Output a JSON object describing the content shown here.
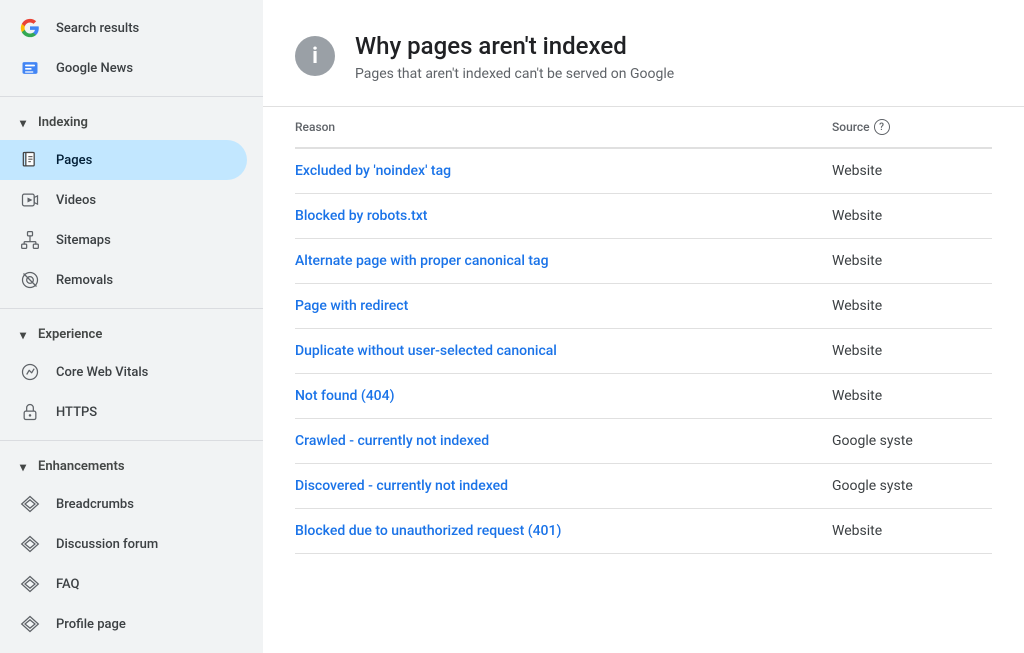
{
  "sidebar": {
    "top_items": [
      {
        "id": "search-results",
        "label": "Search results",
        "icon": "google-icon"
      },
      {
        "id": "google-news",
        "label": "Google News",
        "icon": "google-news-icon"
      }
    ],
    "sections": [
      {
        "id": "indexing",
        "label": "Indexing",
        "expanded": true,
        "items": [
          {
            "id": "pages",
            "label": "Pages",
            "icon": "pages-icon",
            "active": true
          },
          {
            "id": "videos",
            "label": "Videos",
            "icon": "videos-icon",
            "active": false
          },
          {
            "id": "sitemaps",
            "label": "Sitemaps",
            "icon": "sitemaps-icon",
            "active": false
          },
          {
            "id": "removals",
            "label": "Removals",
            "icon": "removals-icon",
            "active": false
          }
        ]
      },
      {
        "id": "experience",
        "label": "Experience",
        "expanded": true,
        "items": [
          {
            "id": "core-web-vitals",
            "label": "Core Web Vitals",
            "icon": "core-web-vitals-icon",
            "active": false
          },
          {
            "id": "https",
            "label": "HTTPS",
            "icon": "https-icon",
            "active": false
          }
        ]
      },
      {
        "id": "enhancements",
        "label": "Enhancements",
        "expanded": true,
        "items": [
          {
            "id": "breadcrumbs",
            "label": "Breadcrumbs",
            "icon": "breadcrumbs-icon",
            "active": false
          },
          {
            "id": "discussion-forum",
            "label": "Discussion forum",
            "icon": "discussion-forum-icon",
            "active": false
          },
          {
            "id": "faq",
            "label": "FAQ",
            "icon": "faq-icon",
            "active": false
          },
          {
            "id": "profile-page",
            "label": "Profile page",
            "icon": "profile-page-icon",
            "active": false
          }
        ]
      }
    ]
  },
  "main": {
    "header": {
      "title": "Why pages aren't indexed",
      "subtitle": "Pages that aren't indexed can't be served on Google"
    },
    "table": {
      "columns": {
        "reason": "Reason",
        "source": "Source"
      },
      "rows": [
        {
          "reason": "Excluded by 'noindex' tag",
          "source": "Website"
        },
        {
          "reason": "Blocked by robots.txt",
          "source": "Website"
        },
        {
          "reason": "Alternate page with proper canonical tag",
          "source": "Website"
        },
        {
          "reason": "Page with redirect",
          "source": "Website"
        },
        {
          "reason": "Duplicate without user-selected canonical",
          "source": "Website"
        },
        {
          "reason": "Not found (404)",
          "source": "Website"
        },
        {
          "reason": "Crawled - currently not indexed",
          "source": "Google syste"
        },
        {
          "reason": "Discovered - currently not indexed",
          "source": "Google syste"
        },
        {
          "reason": "Blocked due to unauthorized request (401)",
          "source": "Website"
        }
      ]
    }
  }
}
